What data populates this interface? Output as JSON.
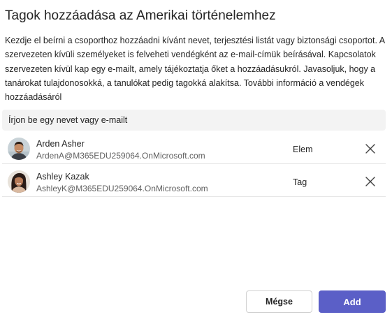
{
  "dialog": {
    "title": "Tagok hozzáadása az Amerikai történelemhez",
    "description": "Kezdje el beírni a csoporthoz hozzáadni kívánt nevet, terjesztési listát vagy biztonsági csoportot. A szervezeten kívüli személyeket is felveheti vendégként az e-mail-címük beírásával. Kapcsolatok szervezeten kívül kap egy e-mailt, amely tájékoztatja őket a hozzáadásukról. Javasoljuk, hogy a tanárokat tulajdonosokká, a tanulókat pedig tagokká alakítsa. ",
    "info_link": "További információ a vendégek hozzáadásáról"
  },
  "search": {
    "placeholder": "Írjon be egy nevet vagy e-mailt"
  },
  "members": [
    {
      "name": "Arden Asher",
      "email": "ArdenA@M365EDU259064.OnMicrosoft.com",
      "role": "Elem",
      "remove_icon": "close-icon"
    },
    {
      "name": "Ashley Kazak",
      "email": "AshleyK@M365EDU259064.OnMicrosoft.com",
      "role": "Tag",
      "remove_icon": "close-icon"
    }
  ],
  "footer": {
    "cancel_label": "Mégse",
    "add_label": "Add"
  },
  "colors": {
    "primary": "#5b5fc7",
    "search_bg": "#f3f3f3",
    "secondary_text": "#616161"
  }
}
